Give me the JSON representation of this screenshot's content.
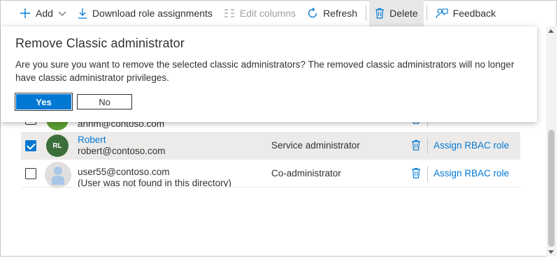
{
  "toolbar": {
    "add_label": "Add",
    "download_label": "Download role assignments",
    "edit_columns_label": "Edit columns",
    "refresh_label": "Refresh",
    "delete_label": "Delete",
    "feedback_label": "Feedback"
  },
  "dialog": {
    "title": "Remove Classic administrator",
    "message": "Are you sure you want to remove the selected classic administrators? The removed classic administrators will no longer have classic administrator privileges.",
    "yes_label": "Yes",
    "no_label": "No"
  },
  "rows": [
    {
      "secondary": "annm@contoso.com",
      "selected": false,
      "avatar_color": "#5c9e31"
    },
    {
      "initials": "RL",
      "primary": "Robert",
      "secondary": "robert@contoso.com",
      "role": "Service administrator",
      "action": "Assign RBAC role",
      "selected": true,
      "avatar_color": "#3b6e3b"
    },
    {
      "primary": "user55@contoso.com",
      "secondary": "(User was not found in this directory)",
      "role": "Co-administrator",
      "action": "Assign RBAC role",
      "selected": false,
      "avatar_icon": "person-placeholder-icon"
    }
  ],
  "colors": {
    "accent": "#0078d4",
    "selected_row": "#edebe9"
  }
}
